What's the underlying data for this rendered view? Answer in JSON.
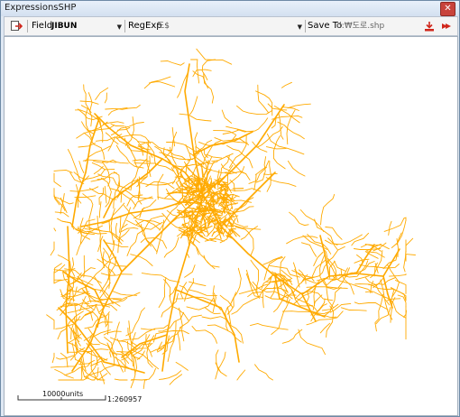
{
  "window": {
    "title": "ExpressionsSHP",
    "close_glyph": "✕"
  },
  "toolbar": {
    "field_label": "Field",
    "field_value": "JIBUN",
    "regexp_label": "RegExp",
    "regexp_value": "도$",
    "save_label": "Save To",
    "save_value": "d:₩도로.shp"
  },
  "map": {
    "line_color": "#ffaa00",
    "scale_label": "10000units",
    "scale_ratio": "1:260957"
  }
}
